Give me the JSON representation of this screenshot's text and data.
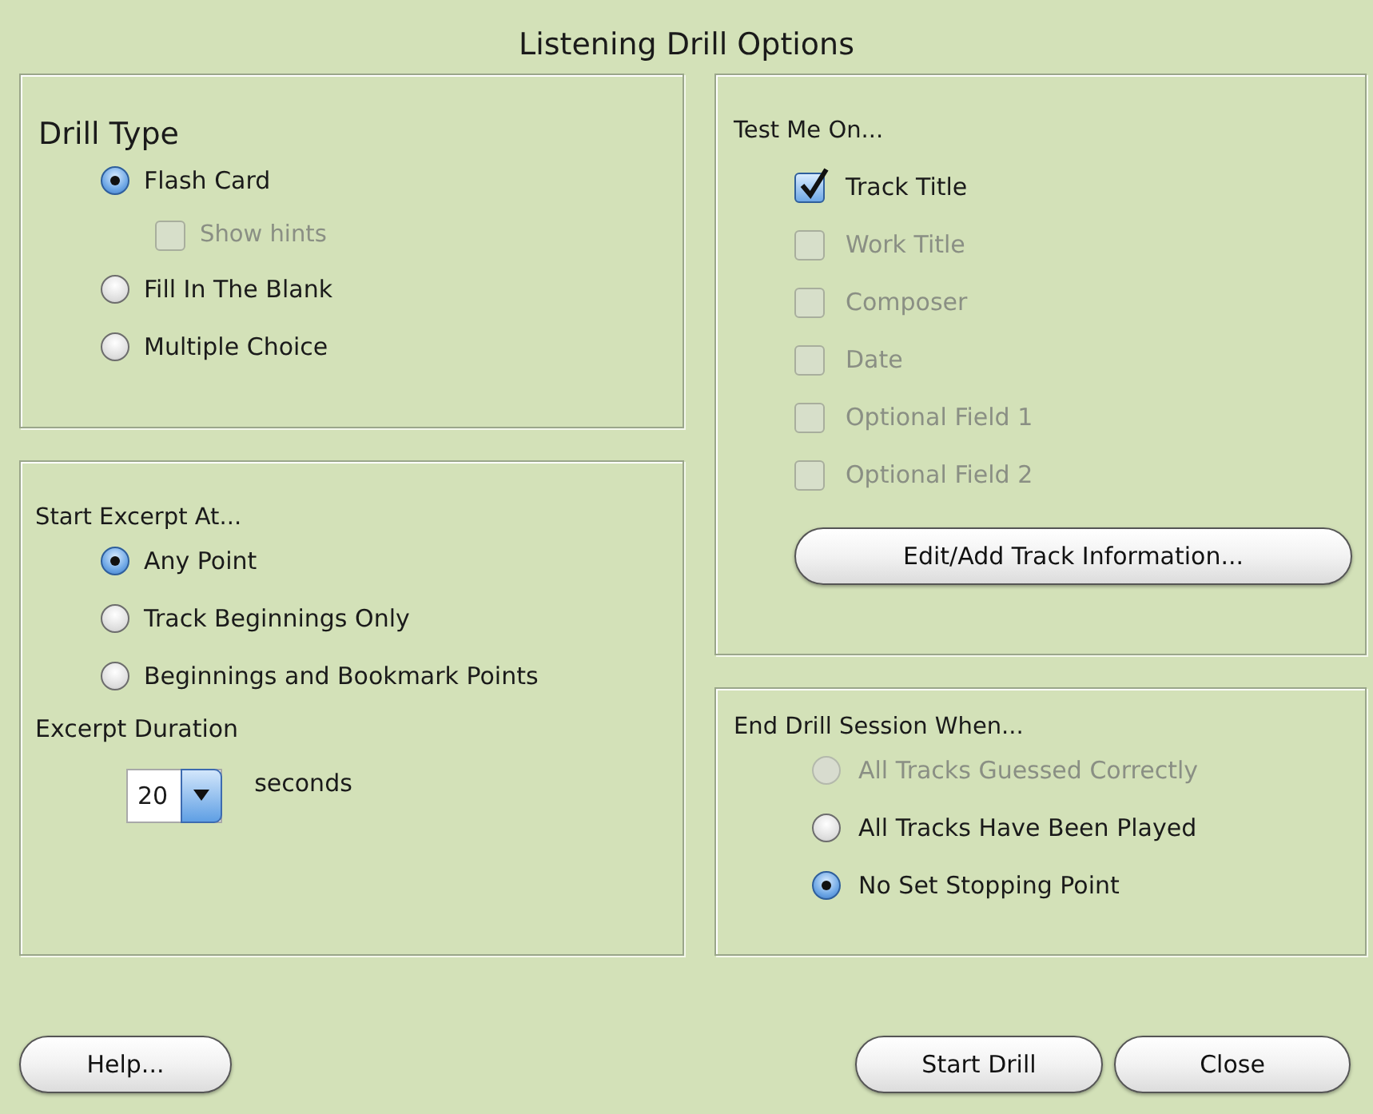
{
  "window": {
    "title": "Listening Drill Options"
  },
  "drill_type": {
    "title": "Drill Type",
    "options": [
      {
        "kind": "radio",
        "label": "Flash Card",
        "selected": true,
        "disabled": false
      },
      {
        "kind": "checkbox",
        "label": "Show hints",
        "checked": false,
        "disabled": true
      },
      {
        "kind": "radio",
        "label": "Fill In The Blank",
        "selected": false,
        "disabled": false
      },
      {
        "kind": "radio",
        "label": "Multiple Choice",
        "selected": false,
        "disabled": false
      }
    ]
  },
  "start_excerpt": {
    "title": "Start Excerpt At...",
    "options": [
      {
        "label": "Any Point",
        "selected": true,
        "disabled": false
      },
      {
        "label": "Track Beginnings Only",
        "selected": false,
        "disabled": false
      },
      {
        "label": "Beginnings and Bookmark Points",
        "selected": false,
        "disabled": false
      }
    ],
    "duration": {
      "label": "Excerpt Duration",
      "value": "20",
      "unit": "seconds"
    }
  },
  "test_me_on": {
    "title": "Test Me On...",
    "fields": [
      {
        "label": "Track Title",
        "checked": true,
        "disabled": false
      },
      {
        "label": "Work Title",
        "checked": false,
        "disabled": true
      },
      {
        "label": "Composer",
        "checked": false,
        "disabled": true
      },
      {
        "label": "Date",
        "checked": false,
        "disabled": true
      },
      {
        "label": "Optional Field 1",
        "checked": false,
        "disabled": true
      },
      {
        "label": "Optional Field 2",
        "checked": false,
        "disabled": true
      }
    ],
    "button": "Edit/Add Track Information..."
  },
  "end_session": {
    "title": "End Drill Session When...",
    "options": [
      {
        "label": "All Tracks Guessed Correctly",
        "selected": false,
        "disabled": true
      },
      {
        "label": "All Tracks Have Been Played",
        "selected": false,
        "disabled": false
      },
      {
        "label": "No Set Stopping Point",
        "selected": true,
        "disabled": false
      }
    ]
  },
  "footer": {
    "left_buttons": [
      "Help..."
    ],
    "right_buttons": [
      "Start Drill",
      "Close"
    ]
  }
}
